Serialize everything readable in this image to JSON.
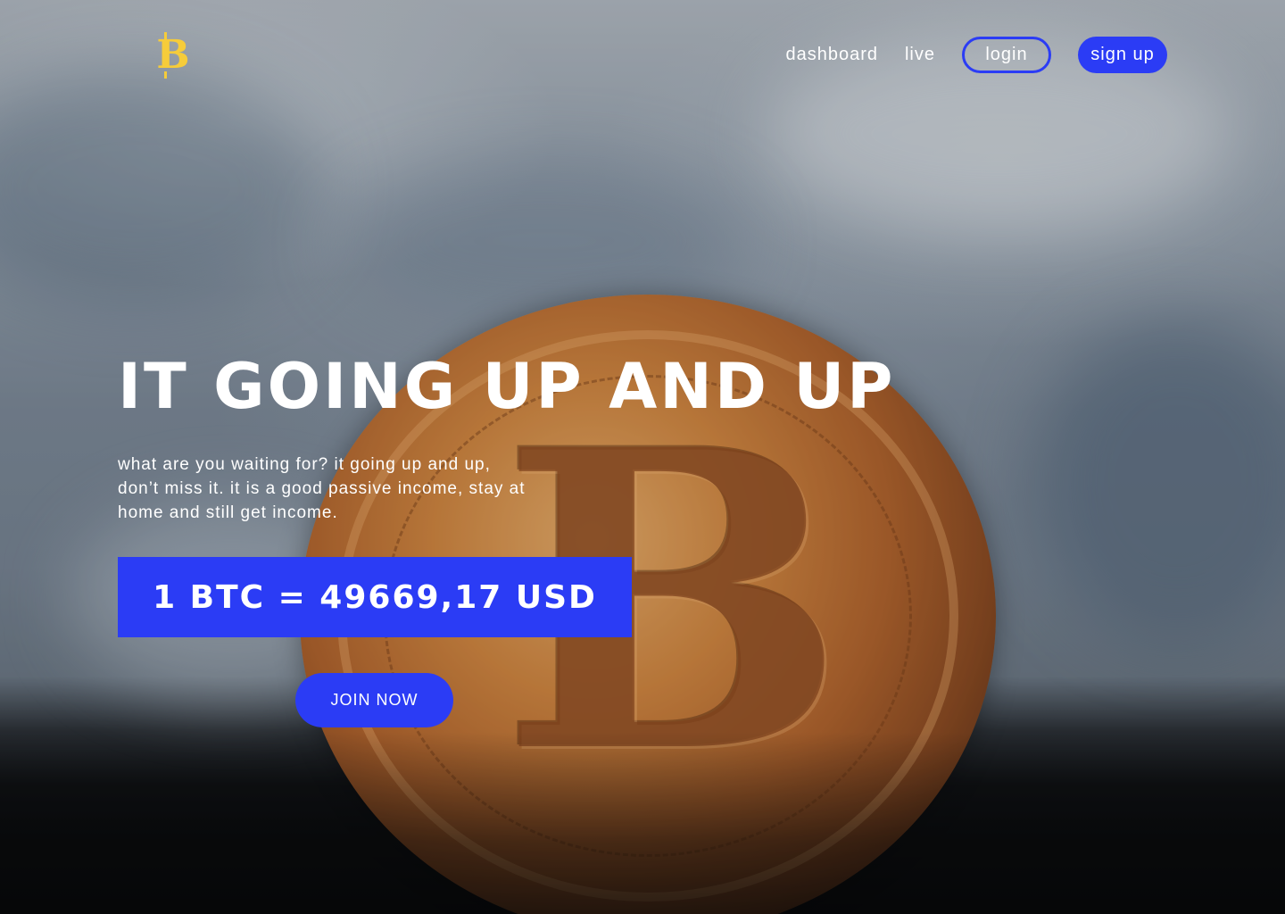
{
  "brand": {
    "logo_icon": "bitcoin-icon",
    "logo_glyph": "B",
    "logo_color": "#f6cc3a"
  },
  "nav": {
    "items": [
      {
        "label": "dashboard"
      },
      {
        "label": "live"
      }
    ],
    "login_label": "login",
    "signup_label": "sign up",
    "accent_color": "#2b3cf5"
  },
  "hero": {
    "headline": "IT GOING UP AND UP",
    "description": "what are you waiting for? it going up and up, don’t miss it. it is a good passive income, stay at home and still get income.",
    "price_text": "1 BTC = 49669,17 USD",
    "cta_label": "JOIN NOW",
    "background_icon": "bitcoin-coin-photo"
  }
}
